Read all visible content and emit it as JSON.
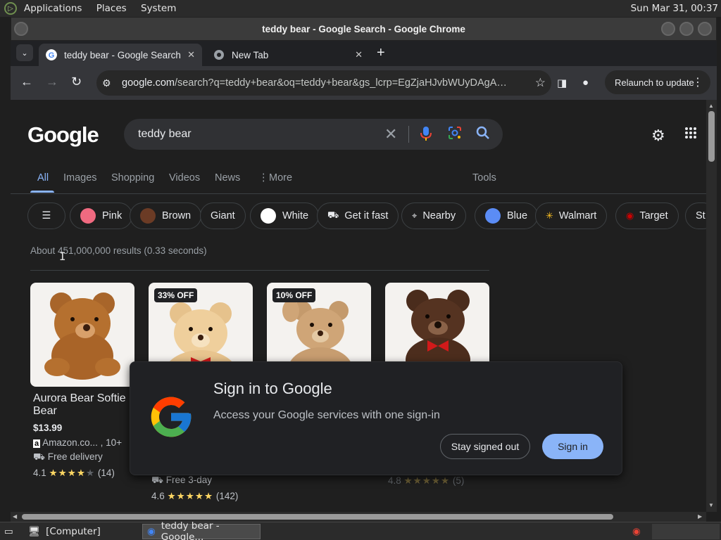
{
  "os": {
    "menu": [
      "Applications",
      "Places",
      "System"
    ],
    "clock": "Sun Mar 31, 00:37"
  },
  "window": {
    "title": "teddy bear - Google Search - Google Chrome"
  },
  "tabs": [
    {
      "label": "teddy bear - Google Search",
      "active": true
    },
    {
      "label": "New Tab",
      "active": false
    }
  ],
  "toolbar": {
    "url_host": "google.com",
    "url_rest": "/search?q=teddy+bear&oq=teddy+bear&gs_lcrp=EgZjaHJvbWUyDAgAEEUY...",
    "relaunch_label": "Relaunch to update"
  },
  "search": {
    "logo": "Google",
    "query": "teddy bear"
  },
  "nav_tabs": [
    "All",
    "Images",
    "Shopping",
    "Videos",
    "News",
    "More",
    "Tools"
  ],
  "chips": [
    {
      "label": "Pink",
      "color": "#f06a80"
    },
    {
      "label": "Brown",
      "color": "#6b3b25"
    },
    {
      "label": "Giant"
    },
    {
      "label": "White",
      "color": "#ffffff"
    },
    {
      "label": "Get it fast"
    },
    {
      "label": "Nearby"
    },
    {
      "label": "Blue",
      "color": "#5b8cf5"
    },
    {
      "label": "Walmart"
    },
    {
      "label": "Target"
    },
    {
      "label": "St"
    }
  ],
  "results_stats": "About 451,000,000 results (0.33 seconds)",
  "products": [
    {
      "name": "Aurora Bear Softie Bear",
      "price": "$13.99",
      "seller": "Amazon.co... , 10+",
      "shipping": "Free delivery",
      "rating": "4.1",
      "reviews": "(14)"
    },
    {
      "badge": "33% OFF",
      "shipping": "Free 3-day",
      "rating": "4.6",
      "reviews": "(142)"
    },
    {
      "badge": "10% OFF"
    },
    {
      "rating": "4.8",
      "reviews": "(5)"
    }
  ],
  "signin": {
    "title": "Sign in to Google",
    "description": "Access your Google services with one sign-in",
    "stay_label": "Stay signed out",
    "sign_label": "Sign in"
  },
  "taskbar": {
    "computer": "[Computer]",
    "chrome": "teddy bear - Google..."
  },
  "colors": {
    "accent": "#8ab4f8",
    "star": "#fdd663"
  }
}
